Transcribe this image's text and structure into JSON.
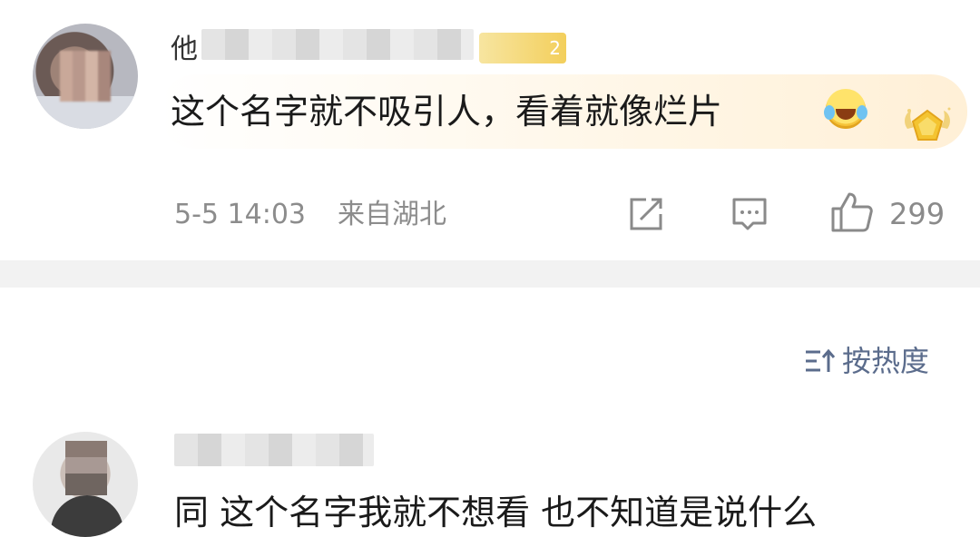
{
  "comments": [
    {
      "username_visible": "他",
      "vip_level": "2",
      "text": "这个名字就不吸引人，看着就像烂片",
      "timestamp": "5-5 14:03",
      "location": "来自湖北",
      "like_count": "299",
      "emoji": "laughing-crying-emoji"
    },
    {
      "text": "同 这个名字我就不想看 也不知道是说什么"
    }
  ],
  "sort": {
    "label": "按热度",
    "icon": "sort-icon"
  },
  "icons": {
    "share": "share-icon",
    "comment": "comment-icon",
    "like": "thumbs-up-icon",
    "medal": "medal-badge-icon"
  },
  "colors": {
    "meta_gray": "#8c8c8c",
    "sort_blue": "#5b6c8c",
    "separator": "#f2f2f2",
    "vip_gold": "#f3cf5c"
  }
}
